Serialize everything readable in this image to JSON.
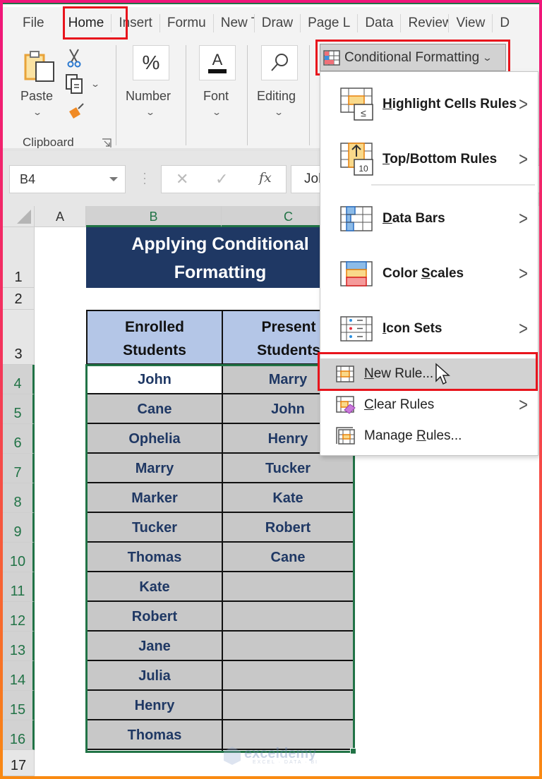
{
  "ribbon_tabs": [
    "File",
    "Home",
    "Insert",
    "Formu",
    "New Ta",
    "Draw",
    "Page L",
    "Data",
    "Review",
    "View",
    "D"
  ],
  "active_tab": "Home",
  "ribbon": {
    "clipboard": {
      "paste_label": "Paste",
      "group_label": "Clipboard"
    },
    "number_label": "Number",
    "font_label": "Font",
    "editing_label": "Editing",
    "conditional_formatting_label": "Conditional Formatting"
  },
  "formula_bar": {
    "name_box": "B4",
    "fx_label": "fx",
    "content": "John"
  },
  "grid": {
    "columns": [
      "A",
      "B",
      "C"
    ],
    "rows": [
      "1",
      "2",
      "3",
      "4",
      "5",
      "6",
      "7",
      "8",
      "9",
      "10",
      "11",
      "12",
      "13",
      "14",
      "15",
      "16",
      "17"
    ],
    "title_line1": "Applying Conditional",
    "title_line2": "Formatting",
    "header_b_line1": "Enrolled",
    "header_b_line2": "Students",
    "header_c_line1": "Present",
    "header_c_line2": "Students",
    "enrolled": [
      "John",
      "Cane",
      "Ophelia",
      "Marry",
      "Marker",
      "Tucker",
      "Thomas",
      "Kate",
      "Robert",
      "Jane",
      "Julia",
      "Henry",
      "Thomas"
    ],
    "present": [
      "Marry",
      "John",
      "Henry",
      "Tucker",
      "Kate",
      "Robert",
      "Cane",
      "",
      "",
      "",
      "",
      "",
      ""
    ]
  },
  "menu": {
    "items": [
      {
        "key": "H",
        "rest": "ighlight Cells Rules",
        "has_submenu": true
      },
      {
        "key": "T",
        "rest": "op/Bottom Rules",
        "has_submenu": true
      },
      {
        "key": "D",
        "rest": "ata Bars",
        "has_submenu": true
      },
      {
        "pre": "Color ",
        "key": "S",
        "rest": "cales",
        "has_submenu": true
      },
      {
        "key": "I",
        "rest": "con Sets",
        "has_submenu": true
      },
      {
        "key": "N",
        "rest": "ew Rule...",
        "has_submenu": false
      },
      {
        "key": "C",
        "rest": "lear Rules",
        "has_submenu": true
      },
      {
        "pre": "Manage ",
        "key": "R",
        "rest": "ules...",
        "has_submenu": false
      }
    ],
    "arrow": ">"
  },
  "colors": {
    "excel_green": "#217346",
    "highlight_red": "#e8141c",
    "title_fill": "#1f3864",
    "header_fill": "#b4c6e7",
    "cell_fill": "#c8c8c8"
  },
  "watermark": {
    "name": "exceldemy",
    "tagline": "EXCEL · DATA · BI"
  }
}
